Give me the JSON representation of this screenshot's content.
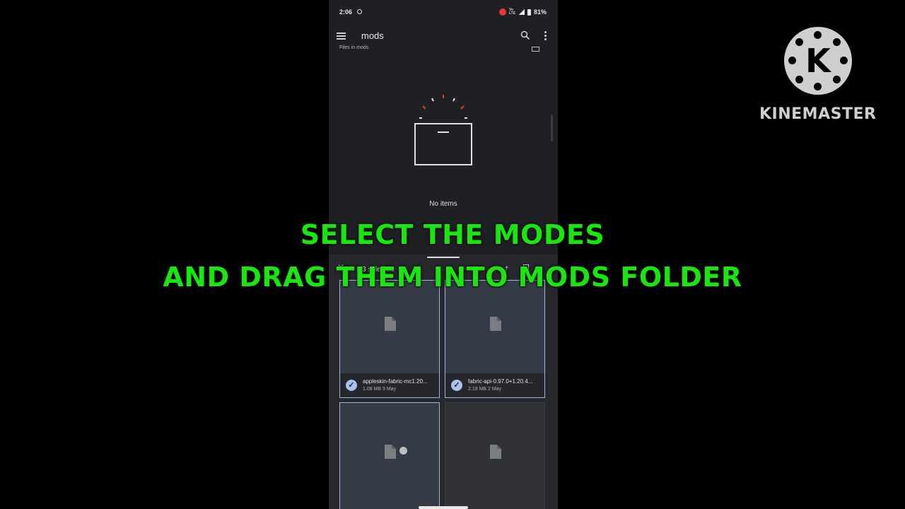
{
  "status_bar": {
    "time": "2:06",
    "battery": "81%",
    "net_label": "Vo LTE"
  },
  "app_bar": {
    "title": "mods",
    "subtitle": "Files in mods"
  },
  "empty_state": {
    "text": "No items"
  },
  "bottom_sheet": {
    "selection_label": "3 selected",
    "files": [
      {
        "name": "appleskin-fabric-mc1.20...",
        "meta": "1.08 MB  9 May",
        "selected": true
      },
      {
        "name": "fabric-api-0.97.0+1.20.4...",
        "meta": "2.19 MB  2 May",
        "selected": true
      },
      {
        "name": "",
        "meta": "",
        "selected": true
      },
      {
        "name": "",
        "meta": "",
        "selected": false
      }
    ]
  },
  "overlay_caption": {
    "line1": "SELECT THE MODES",
    "line2": "AND DRAG THEM INTO MODS FOLDER"
  },
  "watermark": {
    "logo_letter": "K",
    "name": "KINEMASTER"
  },
  "colors": {
    "caption": "#19e60f",
    "selection_border": "#9cb7e6",
    "accent_red": "#e53935"
  }
}
